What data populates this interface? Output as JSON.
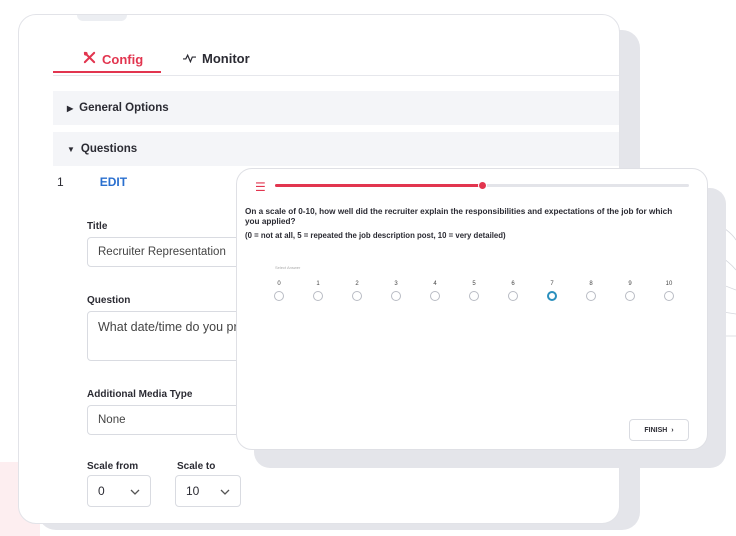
{
  "tabs": {
    "config": "Config",
    "monitor": "Monitor"
  },
  "sections": {
    "general": "General Options",
    "questions": "Questions"
  },
  "question_row": {
    "number": "1",
    "edit": "EDIT"
  },
  "fields": {
    "title_label": "Title",
    "title_value": "Recruiter Representation",
    "question_label": "Question",
    "question_value": "What date/time do you pref",
    "media_label": "Additional Media Type",
    "media_value": "None",
    "scale_from_label": "Scale from",
    "scale_to_label": "Scale to",
    "scale_from_value": "0",
    "scale_to_value": "10"
  },
  "preview": {
    "progress": 0.5,
    "question": "On a scale of 0-10, how well did the recruiter explain the responsibilities and expectations of the job for which you applied?",
    "legend": "(0 = not at all, 5 = repeated the job description post, 10 = very detailed)",
    "select_answer": "Select Answer",
    "options": [
      "0",
      "1",
      "2",
      "3",
      "4",
      "5",
      "6",
      "7",
      "8",
      "9",
      "10"
    ],
    "selected": "7",
    "finish": "FINISH"
  },
  "colors": {
    "accent": "#e2354f",
    "link": "#2a6fcf",
    "selected_radio": "#2a8fbd"
  },
  "icons": {
    "config": "wrench-icon",
    "monitor": "pulse-icon",
    "list": "list-icon",
    "chevron": "chevron-down-icon",
    "finish": "chevron-right-icon"
  }
}
